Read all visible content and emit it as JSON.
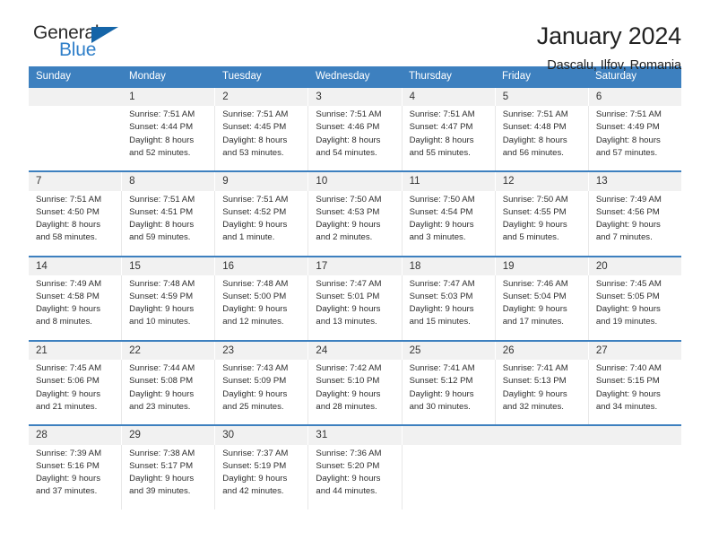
{
  "brand": {
    "name_top": "General",
    "name_bottom": "Blue",
    "color_blue": "#2f7fc9",
    "color_triangle": "#1565a8"
  },
  "header": {
    "title": "January 2024",
    "subtitle": "Dascalu, Ilfov, Romania"
  },
  "theme": {
    "header_bg": "#3d80bf",
    "date_bg": "#f1f1f1",
    "text": "#2e2e2e"
  },
  "calendar": {
    "day_names": [
      "Sunday",
      "Monday",
      "Tuesday",
      "Wednesday",
      "Thursday",
      "Friday",
      "Saturday"
    ],
    "weeks": [
      [
        {
          "date": "",
          "lines": [
            "",
            "",
            "",
            ""
          ],
          "empty": true
        },
        {
          "date": "1",
          "lines": [
            "Sunrise: 7:51 AM",
            "Sunset: 4:44 PM",
            "Daylight: 8 hours",
            "and 52 minutes."
          ]
        },
        {
          "date": "2",
          "lines": [
            "Sunrise: 7:51 AM",
            "Sunset: 4:45 PM",
            "Daylight: 8 hours",
            "and 53 minutes."
          ]
        },
        {
          "date": "3",
          "lines": [
            "Sunrise: 7:51 AM",
            "Sunset: 4:46 PM",
            "Daylight: 8 hours",
            "and 54 minutes."
          ]
        },
        {
          "date": "4",
          "lines": [
            "Sunrise: 7:51 AM",
            "Sunset: 4:47 PM",
            "Daylight: 8 hours",
            "and 55 minutes."
          ]
        },
        {
          "date": "5",
          "lines": [
            "Sunrise: 7:51 AM",
            "Sunset: 4:48 PM",
            "Daylight: 8 hours",
            "and 56 minutes."
          ]
        },
        {
          "date": "6",
          "lines": [
            "Sunrise: 7:51 AM",
            "Sunset: 4:49 PM",
            "Daylight: 8 hours",
            "and 57 minutes."
          ]
        }
      ],
      [
        {
          "date": "7",
          "lines": [
            "Sunrise: 7:51 AM",
            "Sunset: 4:50 PM",
            "Daylight: 8 hours",
            "and 58 minutes."
          ]
        },
        {
          "date": "8",
          "lines": [
            "Sunrise: 7:51 AM",
            "Sunset: 4:51 PM",
            "Daylight: 8 hours",
            "and 59 minutes."
          ]
        },
        {
          "date": "9",
          "lines": [
            "Sunrise: 7:51 AM",
            "Sunset: 4:52 PM",
            "Daylight: 9 hours",
            "and 1 minute."
          ]
        },
        {
          "date": "10",
          "lines": [
            "Sunrise: 7:50 AM",
            "Sunset: 4:53 PM",
            "Daylight: 9 hours",
            "and 2 minutes."
          ]
        },
        {
          "date": "11",
          "lines": [
            "Sunrise: 7:50 AM",
            "Sunset: 4:54 PM",
            "Daylight: 9 hours",
            "and 3 minutes."
          ]
        },
        {
          "date": "12",
          "lines": [
            "Sunrise: 7:50 AM",
            "Sunset: 4:55 PM",
            "Daylight: 9 hours",
            "and 5 minutes."
          ]
        },
        {
          "date": "13",
          "lines": [
            "Sunrise: 7:49 AM",
            "Sunset: 4:56 PM",
            "Daylight: 9 hours",
            "and 7 minutes."
          ]
        }
      ],
      [
        {
          "date": "14",
          "lines": [
            "Sunrise: 7:49 AM",
            "Sunset: 4:58 PM",
            "Daylight: 9 hours",
            "and 8 minutes."
          ]
        },
        {
          "date": "15",
          "lines": [
            "Sunrise: 7:48 AM",
            "Sunset: 4:59 PM",
            "Daylight: 9 hours",
            "and 10 minutes."
          ]
        },
        {
          "date": "16",
          "lines": [
            "Sunrise: 7:48 AM",
            "Sunset: 5:00 PM",
            "Daylight: 9 hours",
            "and 12 minutes."
          ]
        },
        {
          "date": "17",
          "lines": [
            "Sunrise: 7:47 AM",
            "Sunset: 5:01 PM",
            "Daylight: 9 hours",
            "and 13 minutes."
          ]
        },
        {
          "date": "18",
          "lines": [
            "Sunrise: 7:47 AM",
            "Sunset: 5:03 PM",
            "Daylight: 9 hours",
            "and 15 minutes."
          ]
        },
        {
          "date": "19",
          "lines": [
            "Sunrise: 7:46 AM",
            "Sunset: 5:04 PM",
            "Daylight: 9 hours",
            "and 17 minutes."
          ]
        },
        {
          "date": "20",
          "lines": [
            "Sunrise: 7:45 AM",
            "Sunset: 5:05 PM",
            "Daylight: 9 hours",
            "and 19 minutes."
          ]
        }
      ],
      [
        {
          "date": "21",
          "lines": [
            "Sunrise: 7:45 AM",
            "Sunset: 5:06 PM",
            "Daylight: 9 hours",
            "and 21 minutes."
          ]
        },
        {
          "date": "22",
          "lines": [
            "Sunrise: 7:44 AM",
            "Sunset: 5:08 PM",
            "Daylight: 9 hours",
            "and 23 minutes."
          ]
        },
        {
          "date": "23",
          "lines": [
            "Sunrise: 7:43 AM",
            "Sunset: 5:09 PM",
            "Daylight: 9 hours",
            "and 25 minutes."
          ]
        },
        {
          "date": "24",
          "lines": [
            "Sunrise: 7:42 AM",
            "Sunset: 5:10 PM",
            "Daylight: 9 hours",
            "and 28 minutes."
          ]
        },
        {
          "date": "25",
          "lines": [
            "Sunrise: 7:41 AM",
            "Sunset: 5:12 PM",
            "Daylight: 9 hours",
            "and 30 minutes."
          ]
        },
        {
          "date": "26",
          "lines": [
            "Sunrise: 7:41 AM",
            "Sunset: 5:13 PM",
            "Daylight: 9 hours",
            "and 32 minutes."
          ]
        },
        {
          "date": "27",
          "lines": [
            "Sunrise: 7:40 AM",
            "Sunset: 5:15 PM",
            "Daylight: 9 hours",
            "and 34 minutes."
          ]
        }
      ],
      [
        {
          "date": "28",
          "lines": [
            "Sunrise: 7:39 AM",
            "Sunset: 5:16 PM",
            "Daylight: 9 hours",
            "and 37 minutes."
          ]
        },
        {
          "date": "29",
          "lines": [
            "Sunrise: 7:38 AM",
            "Sunset: 5:17 PM",
            "Daylight: 9 hours",
            "and 39 minutes."
          ]
        },
        {
          "date": "30",
          "lines": [
            "Sunrise: 7:37 AM",
            "Sunset: 5:19 PM",
            "Daylight: 9 hours",
            "and 42 minutes."
          ]
        },
        {
          "date": "31",
          "lines": [
            "Sunrise: 7:36 AM",
            "Sunset: 5:20 PM",
            "Daylight: 9 hours",
            "and 44 minutes."
          ]
        },
        {
          "date": "",
          "lines": [
            "",
            "",
            "",
            ""
          ],
          "empty": true
        },
        {
          "date": "",
          "lines": [
            "",
            "",
            "",
            ""
          ],
          "empty": true
        },
        {
          "date": "",
          "lines": [
            "",
            "",
            "",
            ""
          ],
          "empty": true
        }
      ]
    ]
  }
}
